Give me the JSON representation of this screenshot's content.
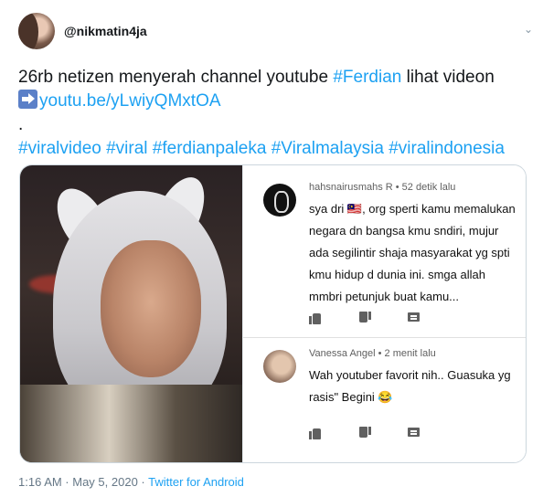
{
  "tweet": {
    "handle": "@nikmatin4ja",
    "line1_prefix": "26rb netizen menyerah channel youtube ",
    "line1_hashtag": "#Ferdian",
    "line1_suffix": " lihat videon",
    "link_text": "youtu.be/yLwiyQMxtOA",
    "dot": ".",
    "hashtags": "#viralvideo #viral #ferdianpaleka #Viralmalaysia #viralindonesia"
  },
  "media": {
    "comments": [
      {
        "author_time": "hahsnairusmahs R • 52 detik lalu",
        "body": "sya dri 🇲🇾, org sperti kamu memalukan negara dn bangsa kmu sndiri, mujur ada segilintir shaja masyarakat yg spti kmu hidup d dunia ini. smga allah mmbri petunjuk buat kamu..."
      },
      {
        "author_time": "Vanessa Angel • 2 menit lalu",
        "body": "Wah youtuber favorit nih.. Guasuka yg rasis\" Begini 😂"
      }
    ]
  },
  "footer": {
    "time_date": "1:16 AM · May 5, 2020 · ",
    "source": "Twitter for Android"
  },
  "colors": {
    "link": "#1da1f2",
    "text": "#14171a",
    "muted": "#657786"
  },
  "icons": [
    "caret-down-icon",
    "arrow-right-emoji-icon",
    "thumbs-up-icon",
    "thumbs-down-icon",
    "reply-icon"
  ]
}
